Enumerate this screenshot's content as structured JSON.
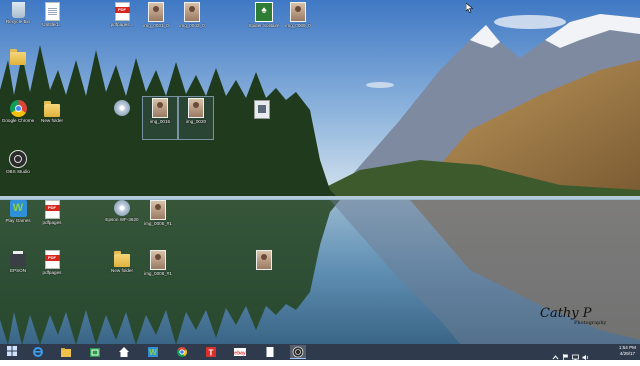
{
  "desktop_icons": [
    {
      "key": "recycle-bin-icon",
      "label": "Recycle Bin",
      "glyph": "bin"
    },
    {
      "key": "shortcut-doc-icon",
      "label": "Untitled...",
      "glyph": "doc"
    },
    {
      "key": "pdf-icon",
      "label": "pdfpages...",
      "glyph": "pdf"
    },
    {
      "key": "photo-icon",
      "label": "img_0031_0",
      "glyph": "photo"
    },
    {
      "key": "photo-icon",
      "label": "img_0042_0",
      "glyph": "photo"
    },
    {
      "key": "solitaire-icon",
      "label": "Spider Solitaire",
      "glyph": "cards"
    },
    {
      "key": "photo-icon",
      "label": "img_0069_0",
      "glyph": "photo"
    },
    {
      "key": "folder-icon",
      "label": "",
      "glyph": "folder"
    },
    {
      "key": "chrome-icon",
      "label": "Google Chrome",
      "glyph": "chrome"
    },
    {
      "key": "folder-icon",
      "label": "New folder",
      "glyph": "folder"
    },
    {
      "key": "disc-icon",
      "label": "",
      "glyph": "disc"
    },
    {
      "key": "photo-icon",
      "label": "img_0015",
      "glyph": "photo"
    },
    {
      "key": "photo-icon",
      "label": "img_0020",
      "glyph": "photo"
    },
    {
      "key": "exe-icon",
      "label": "",
      "glyph": "exe"
    },
    {
      "key": "obs-icon",
      "label": "OBS Studio",
      "glyph": "obs"
    },
    {
      "key": "games-icon",
      "label": "Play Games",
      "glyph": "wgame"
    },
    {
      "key": "pdf-icon",
      "label": "pdfpages",
      "glyph": "pdf"
    },
    {
      "key": "disc-icon",
      "label": "Epson WF-3620",
      "glyph": "disc"
    },
    {
      "key": "photo-icon",
      "label": "img_0005_#1",
      "glyph": "photo"
    },
    {
      "key": "printer-icon",
      "label": "EPSON",
      "glyph": "epson"
    },
    {
      "key": "pdf-icon",
      "label": "pdfpages",
      "glyph": "pdf"
    },
    {
      "key": "folder-icon",
      "label": "New folder",
      "glyph": "folder"
    },
    {
      "key": "photo-icon",
      "label": "img_0008_#1",
      "glyph": "photo"
    },
    {
      "key": "photo-icon",
      "label": "",
      "glyph": "photo"
    }
  ],
  "watermark": {
    "signature": "Cathy P",
    "sub": "Photography"
  },
  "taskbar": {
    "pinned": [
      {
        "key": "start-button",
        "label": "Start"
      },
      {
        "key": "ie-taskbar-button",
        "label": "Internet Explorer"
      },
      {
        "key": "file-explorer-taskbar-button",
        "label": "File Explorer"
      },
      {
        "key": "store-taskbar-button",
        "label": "Store"
      },
      {
        "key": "home-taskbar-button",
        "label": "Home"
      },
      {
        "key": "games-taskbar-button",
        "label": "Play Games"
      },
      {
        "key": "chrome-taskbar-button",
        "label": "Google Chrome"
      },
      {
        "key": "t-app-taskbar-button",
        "label": "T"
      },
      {
        "key": "ebay-taskbar-button",
        "label": "ebay"
      },
      {
        "key": "doc-taskbar-button",
        "label": "Document"
      },
      {
        "key": "obs-taskbar-button",
        "label": "OBS Studio"
      }
    ],
    "clock_time": "1:54 PM",
    "clock_date": "4/29/17"
  },
  "colors": {
    "taskbar": "#122034",
    "accent": "#9cc4ff"
  }
}
